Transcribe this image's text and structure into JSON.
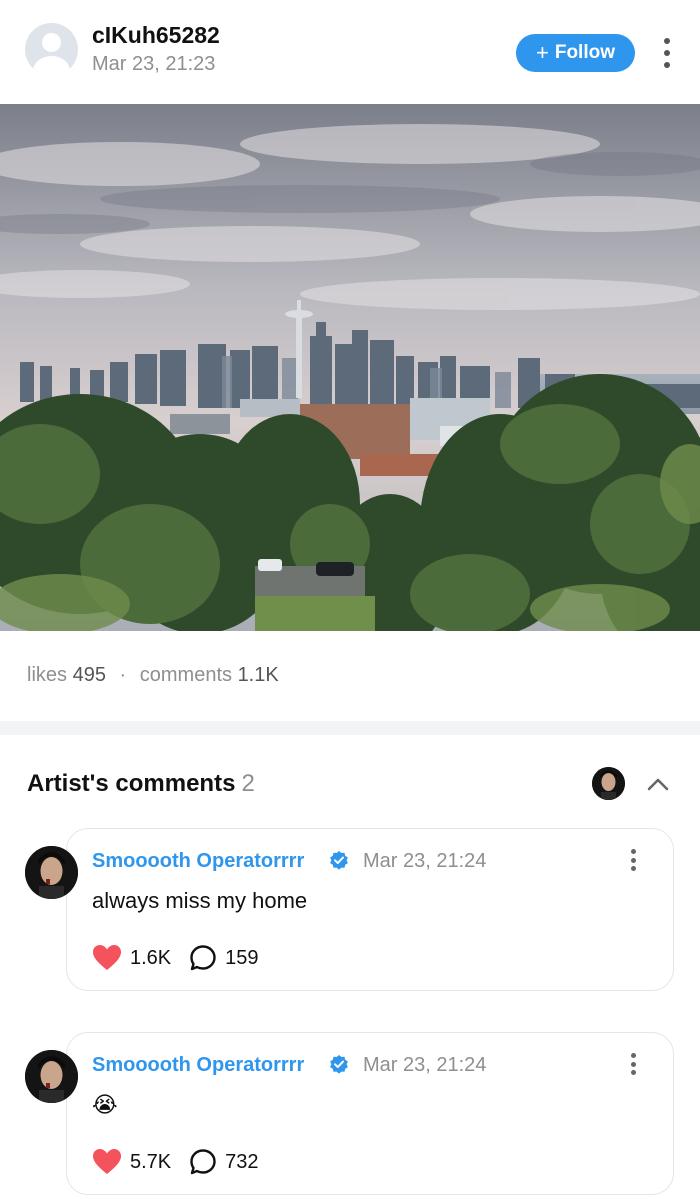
{
  "post": {
    "username": "cIKuh65282",
    "date": "Mar 23, 21:23",
    "follow_label": "Follow"
  },
  "stats": {
    "likes_label": "likes",
    "likes_value": "495",
    "separator": "·",
    "comments_label": "comments",
    "comments_value": "1.1K"
  },
  "artist_comments": {
    "title": "Artist's comments",
    "count": "2",
    "items": [
      {
        "author": "Smooooth Operatorrrr",
        "date": "Mar 23, 21:24",
        "text": "always miss my home",
        "likes": "1.6K",
        "replies": "159"
      },
      {
        "author": "Smooooth Operatorrrr",
        "date": "Mar 23, 21:24",
        "text": "😭",
        "likes": "5.7K",
        "replies": "732"
      }
    ]
  },
  "colors": {
    "accent": "#2f96ee",
    "like_red": "#f4525c",
    "muted": "#8e8e93"
  },
  "icons": [
    "default-avatar-icon",
    "plus-icon",
    "more-vertical-icon",
    "chevron-up-icon",
    "verified-badge-icon",
    "heart-icon",
    "comment-bubble-icon"
  ]
}
